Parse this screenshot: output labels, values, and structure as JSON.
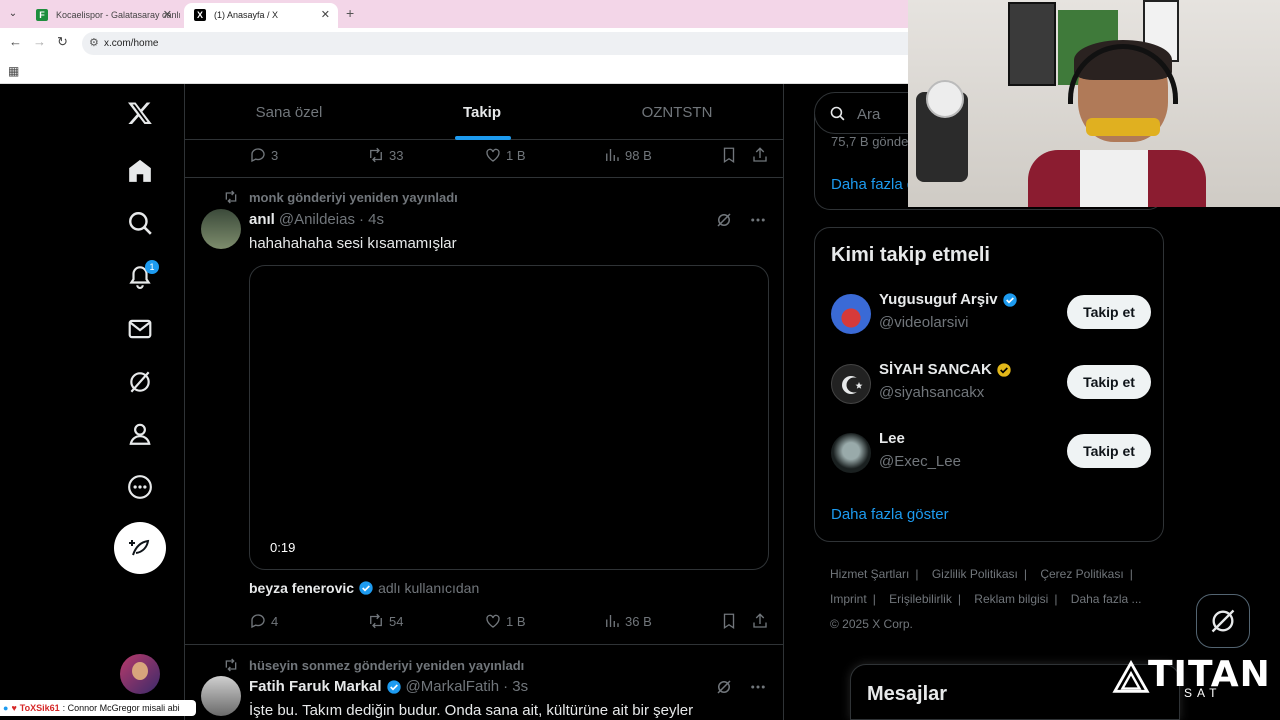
{
  "browser": {
    "tabs": [
      {
        "title": "Kocaelispor - Galatasaray canlı",
        "active": false
      },
      {
        "title": "(1) Anasayfa / X",
        "active": true
      }
    ],
    "url": "x.com/home"
  },
  "sidebar": {
    "notification_badge": "1"
  },
  "feed_tabs": [
    "Sana özel",
    "Takip",
    "OZNTSTN"
  ],
  "top_actions": {
    "replies": "3",
    "reposts": "33",
    "likes": "1 B",
    "views": "98 B"
  },
  "tweet1": {
    "repost_by": "monk gönderiyi yeniden yayınladı",
    "name": "anıl",
    "handle": "@Anildeias",
    "time": "· 4s",
    "text": "hahahahaha sesi kısamamışlar",
    "video_time": "0:19",
    "tag_name": "beyza fenerovic",
    "tag_suffix": "adlı kullanıcıdan",
    "actions": {
      "replies": "4",
      "reposts": "54",
      "likes": "1 B",
      "views": "36 B"
    }
  },
  "tweet2": {
    "repost_by": "hüseyin sonmez gönderiyi yeniden yayınladı",
    "name": "Fatih Faruk Markal",
    "handle": "@MarkalFatih",
    "time": "· 3s",
    "text": "İşte bu. Takım dediğin budur. Onda sana ait, kültürüne ait bir şeyler"
  },
  "right": {
    "search_placeholder": "Ara",
    "trend_partial": "75,7 B gönderi",
    "show_more_1": "Daha fazla göster",
    "follow_title": "Kimi takip etmeli",
    "follows": [
      {
        "name": "Yugusuguf Arşiv",
        "handle": "@videolarsivi",
        "verified": "blue",
        "button": "Takip et"
      },
      {
        "name": "SİYAH SANCAK",
        "handle": "@siyahsancakx",
        "verified": "gold",
        "button": "Takip et"
      },
      {
        "name": "Lee",
        "handle": "@Exec_Lee",
        "verified": "none",
        "button": "Takip et"
      }
    ],
    "show_more_2": "Daha fazla göster",
    "footer_links": [
      "Hizmet Şartları",
      "Gizlilik Politikası",
      "Çerez Politikası",
      "Imprint",
      "Erişilebilirlik",
      "Reklam bilgisi",
      "Daha fazla ..."
    ],
    "copyright": "© 2025 X Corp."
  },
  "messages_title": "Mesajlar",
  "overlay": {
    "chat_user": "ToXSik61",
    "chat_text": ": Connor McGregor misali abi",
    "brand": "TITAN",
    "brand_sub": "SAT"
  },
  "colors": {
    "accent": "#1d9bf0",
    "gold": "#e2b719",
    "border": "#2f3336",
    "muted": "#71767b"
  }
}
